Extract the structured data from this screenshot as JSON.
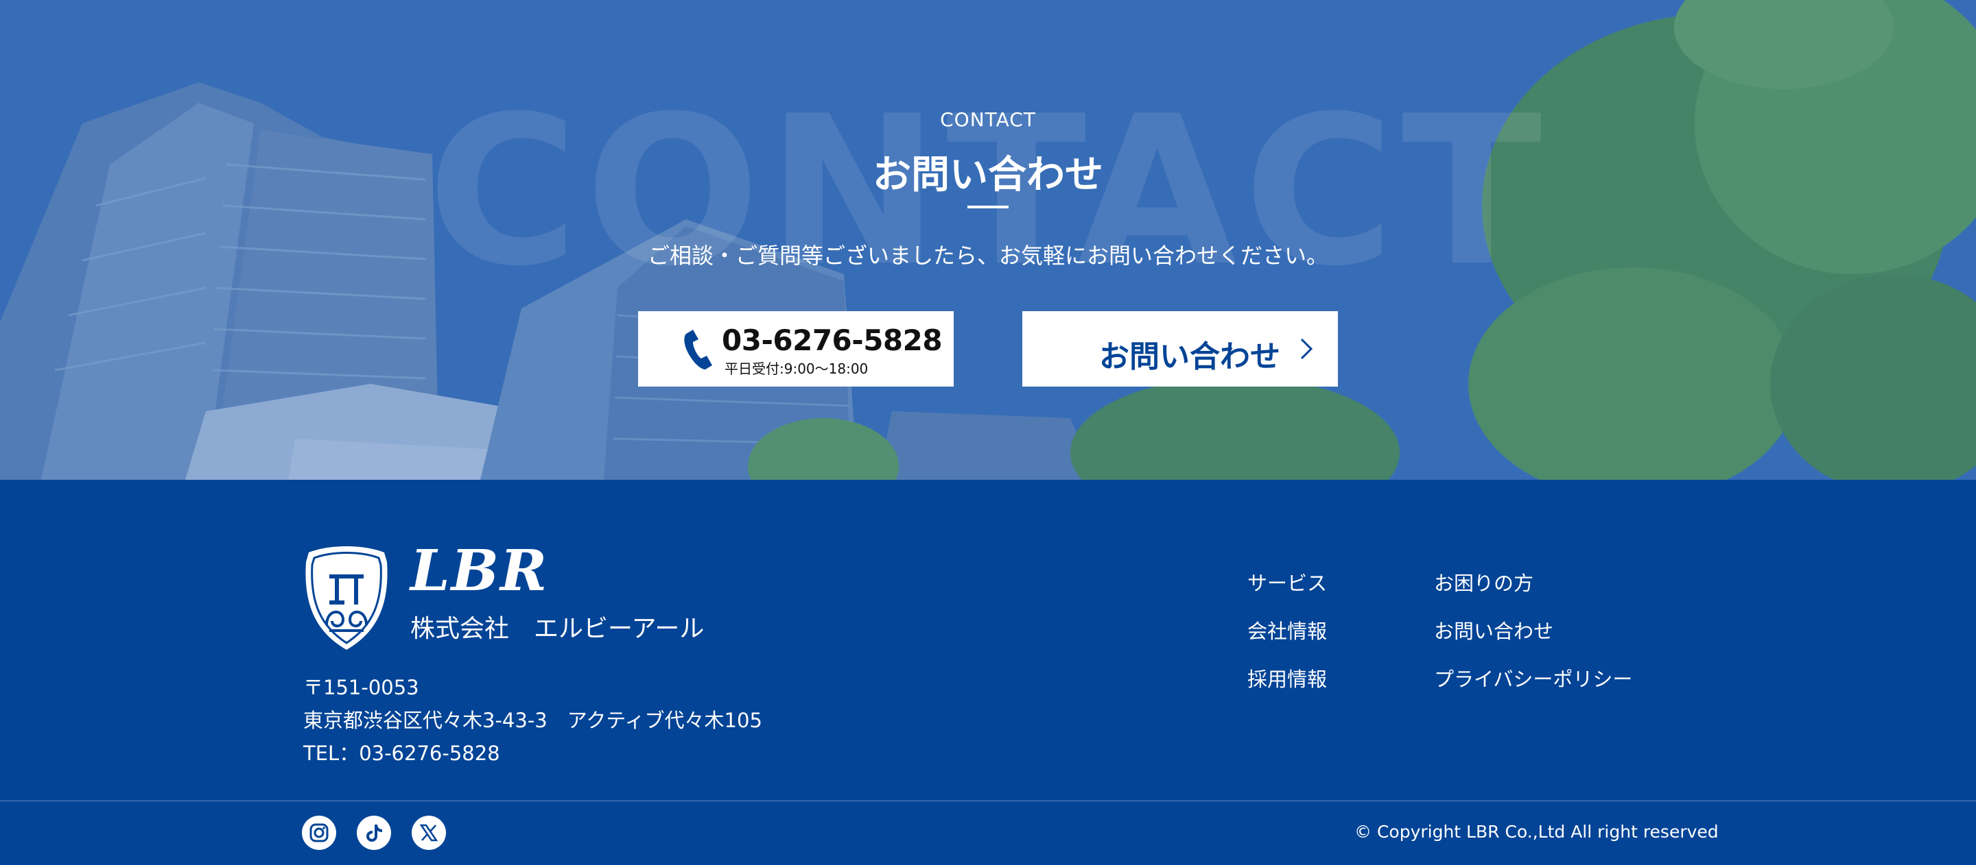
{
  "contact": {
    "watermark": "CONTACT",
    "eyebrow": "CONTACT",
    "title": "お問い合わせ",
    "lead": "ご相談・ご質問等ございましたら、お気軽にお問い合わせください。",
    "phone_number": "03-6276-5828",
    "phone_hours": "平日受付:9:00～18:00",
    "form_button_label": "お問い合わせ"
  },
  "footer": {
    "brand": "LBR",
    "company_name": "株式会社　エルビーアール",
    "postal": "〒151-0053",
    "address": "東京都渋谷区代々木3-43-3　アクティブ代々木105",
    "tel": "TEL：03-6276-5828",
    "nav": [
      "サービス",
      "会社情報",
      "採用情報",
      "お困りの方",
      "お問い合わせ",
      "プライバシーポリシー"
    ],
    "social": [
      "instagram-icon",
      "tiktok-icon",
      "x-icon"
    ],
    "copyright": "© Copyright LBR Co.,Ltd All right reserved"
  },
  "colors": {
    "primary": "#034496",
    "hero_blue": "#4a7fc0",
    "white": "#ffffff"
  }
}
